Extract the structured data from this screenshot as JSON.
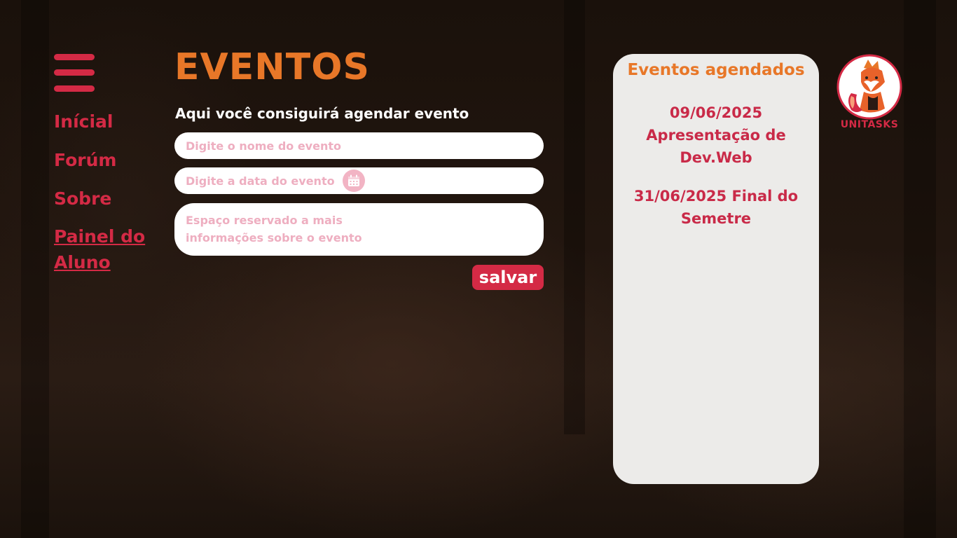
{
  "nav": {
    "items": [
      {
        "label": "Inícial"
      },
      {
        "label": "Forúm"
      },
      {
        "label": "Sobre"
      },
      {
        "label": "Painel do Aluno"
      }
    ]
  },
  "page": {
    "title": "EVENTOS",
    "subtitle": "Aqui você consiguirá agendar evento"
  },
  "form": {
    "name_placeholder": "Digite o nome do evento",
    "date_placeholder": "Digite a data do evento",
    "info_placeholder": "Espaço reservado a mais informações sobre o evento",
    "save_label": "salvar"
  },
  "scheduled": {
    "title": "Eventos agendados",
    "events": [
      {
        "text": "09/06/2025 Apresentação de Dev.Web"
      },
      {
        "text": "31/06/2025 Final do Semetre"
      }
    ]
  },
  "brand": {
    "logo_text": "UNITASKS"
  },
  "colors": {
    "accent_red": "#d42a45",
    "accent_orange": "#e87728",
    "panel_bg": "#ecebe9",
    "placeholder_pink": "#eeaec0"
  },
  "icons": {
    "menu": "hamburger-icon",
    "date": "calendar-icon",
    "logo": "fox-logo"
  }
}
